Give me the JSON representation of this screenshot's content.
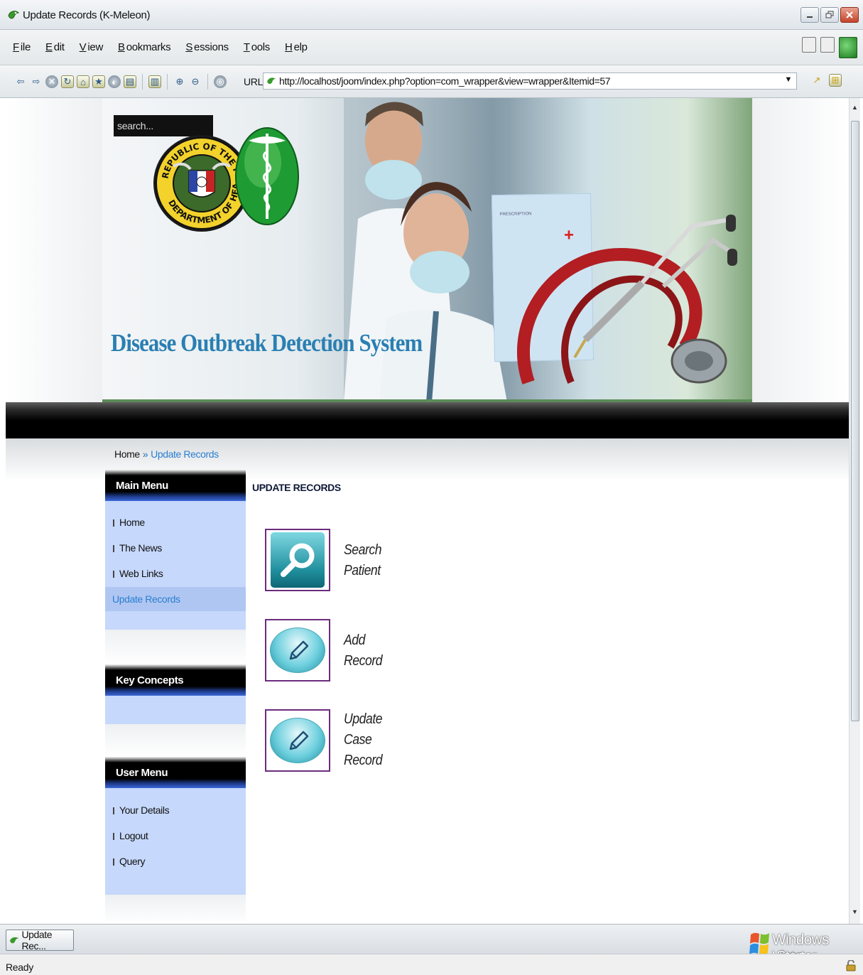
{
  "window": {
    "title": "Update Records (K-Meleon)",
    "controls": [
      "minimize",
      "restore",
      "close"
    ]
  },
  "menubar": {
    "items": [
      {
        "label": "File",
        "accel": "F",
        "rest": "ile"
      },
      {
        "label": "Edit",
        "accel": "E",
        "rest": "dit"
      },
      {
        "label": "View",
        "accel": "V",
        "rest": "iew"
      },
      {
        "label": "Bookmarks",
        "accel": "B",
        "rest": "ookmarks"
      },
      {
        "label": "Sessions",
        "accel": "S",
        "rest": "essions"
      },
      {
        "label": "Tools",
        "accel": "T",
        "rest": "ools"
      },
      {
        "label": "Help",
        "accel": "H",
        "rest": "elp"
      }
    ]
  },
  "toolbar": {
    "url_label": "URL:",
    "url": "http://localhost/joom/index.php?option=com_wrapper&view=wrapper&Itemid=57"
  },
  "page": {
    "search_placeholder": "search...",
    "site_title": "Disease Outbreak Detection System",
    "seal_top_text": "REPUBLIC OF THE PHILIPPINES",
    "seal_bottom_text": "DEPARTMENT OF HEALTH",
    "prescription_text": "PRESCRIPTION",
    "breadcrumb": {
      "home": "Home",
      "separator": "»",
      "current": "Update Records"
    },
    "content_title": "UPDATE RECORDS",
    "main_menu": {
      "title": "Main Menu",
      "items": [
        {
          "label": "Home"
        },
        {
          "label": "The News"
        },
        {
          "label": "Web Links"
        },
        {
          "label": "Update Records",
          "active": true
        }
      ]
    },
    "key_concepts": {
      "title": "Key Concepts"
    },
    "user_menu": {
      "title": "User Menu",
      "items": [
        {
          "label": "Your Details"
        },
        {
          "label": "Logout"
        },
        {
          "label": "Query"
        }
      ]
    },
    "actions": [
      {
        "label": "Search Patient",
        "lines": [
          "Search",
          "Patient"
        ],
        "icon": "magnifier-icon"
      },
      {
        "label": "Add Record",
        "lines": [
          "Add",
          "Record"
        ],
        "icon": "pencil-icon"
      },
      {
        "label": "Update Case Record",
        "lines": [
          "Update",
          "Case",
          "Record"
        ],
        "icon": "pencil-icon"
      }
    ]
  },
  "taskbar": {
    "task_label": "Update Rec...",
    "os_brand_line1": "Windows Vista",
    "os_brand_line2": "Starter"
  },
  "status": {
    "text": "Ready"
  },
  "colors": {
    "accent_blue": "#2a7fd1",
    "module_body": "#c6d8fb",
    "tile_border": "#6b2c7d",
    "title_blue": "#2a7fb2"
  }
}
